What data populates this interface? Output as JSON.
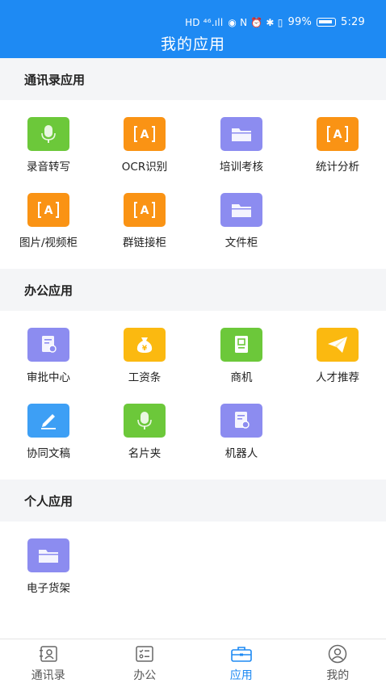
{
  "status_bar": {
    "network": "HD ⁴⁶.ıll",
    "icons_text": "◉ N ⏰ ✱ ▯",
    "battery": "99%",
    "time": "5:29"
  },
  "header": {
    "title": "我的应用"
  },
  "colors": {
    "header": "#1e8af3",
    "green": "#6cc83a",
    "orange": "#fa9314",
    "purple": "#8c8cf0",
    "yellow": "#fbb910",
    "blue": "#3d9ff5",
    "tab_active": "#1e8af3"
  },
  "sections": [
    {
      "title": "通讯录应用",
      "apps": [
        {
          "label": "录音转写",
          "icon": "microphone-icon"
        },
        {
          "label": "OCR识别",
          "icon": "text-recognition-icon"
        },
        {
          "label": "培训考核",
          "icon": "folder-icon"
        },
        {
          "label": "统计分析",
          "icon": "text-recognition-icon"
        },
        {
          "label": "图片/视频柜",
          "icon": "text-recognition-icon"
        },
        {
          "label": "群链接柜",
          "icon": "text-recognition-icon"
        },
        {
          "label": "文件柜",
          "icon": "folder-icon"
        }
      ]
    },
    {
      "title": "办公应用",
      "apps": [
        {
          "label": "审批中心",
          "icon": "approval-document-icon"
        },
        {
          "label": "工资条",
          "icon": "money-bag-icon"
        },
        {
          "label": "商机",
          "icon": "business-card-icon"
        },
        {
          "label": "人才推荐",
          "icon": "paper-plane-icon"
        },
        {
          "label": "协同文稿",
          "icon": "edit-pen-icon"
        },
        {
          "label": "名片夹",
          "icon": "microphone-icon"
        },
        {
          "label": "机器人",
          "icon": "approval-document-icon"
        }
      ]
    },
    {
      "title": "个人应用",
      "apps": [
        {
          "label": "电子货架",
          "icon": "folder-icon"
        }
      ]
    }
  ],
  "tabs": [
    {
      "label": "通讯录",
      "icon": "contacts-icon",
      "active": false
    },
    {
      "label": "办公",
      "icon": "office-icon",
      "active": false
    },
    {
      "label": "应用",
      "icon": "briefcase-icon",
      "active": true
    },
    {
      "label": "我的",
      "icon": "profile-icon",
      "active": false
    }
  ]
}
